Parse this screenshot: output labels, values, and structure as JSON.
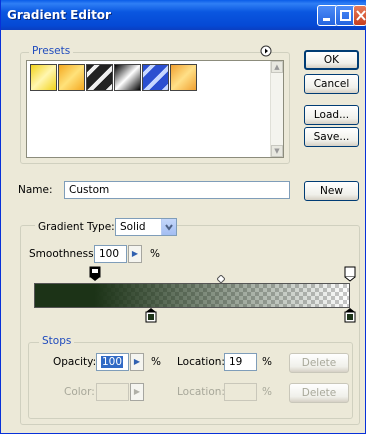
{
  "window": {
    "title": "Gradient Editor"
  },
  "presets": {
    "label": "Presets",
    "swatches": [
      {
        "name": "yellow-transparent",
        "c1": "#f2d21a",
        "c2": "#fff6b0"
      },
      {
        "name": "orange-yellow",
        "c1": "#f4a820",
        "c2": "#ffe27a"
      },
      {
        "name": "black-white-stripes",
        "c1": "#222222",
        "c2": "#f0f0f0"
      },
      {
        "name": "black-white",
        "c1": "#000000",
        "c2": "#ffffff"
      },
      {
        "name": "blue-stripes",
        "c1": "#2b4fd0",
        "c2": "#c8d8ff"
      },
      {
        "name": "orange-yellow-2",
        "c1": "#f0a030",
        "c2": "#ffe088"
      }
    ]
  },
  "buttons": {
    "ok": "OK",
    "cancel": "Cancel",
    "load": "Load...",
    "save": "Save...",
    "new": "New",
    "delete_opacity": "Delete",
    "delete_color": "Delete"
  },
  "name_field": {
    "label": "Name:",
    "value": "Custom"
  },
  "gradient": {
    "type_label": "Gradient Type:",
    "type_value": "Solid",
    "smoothness_label": "Smoothness:",
    "smoothness_value": "100",
    "percent": "%",
    "start_color": "#1c3317",
    "opaque_until": 0.19
  },
  "stops": {
    "label": "Stops",
    "opacity_label": "Opacity:",
    "opacity_value": "100",
    "opacity_unit": "%",
    "location_label": "Location:",
    "location_value": "19",
    "location_unit": "%",
    "color_label": "Color:",
    "color_location_label": "Location:",
    "color_location_unit": "%"
  }
}
